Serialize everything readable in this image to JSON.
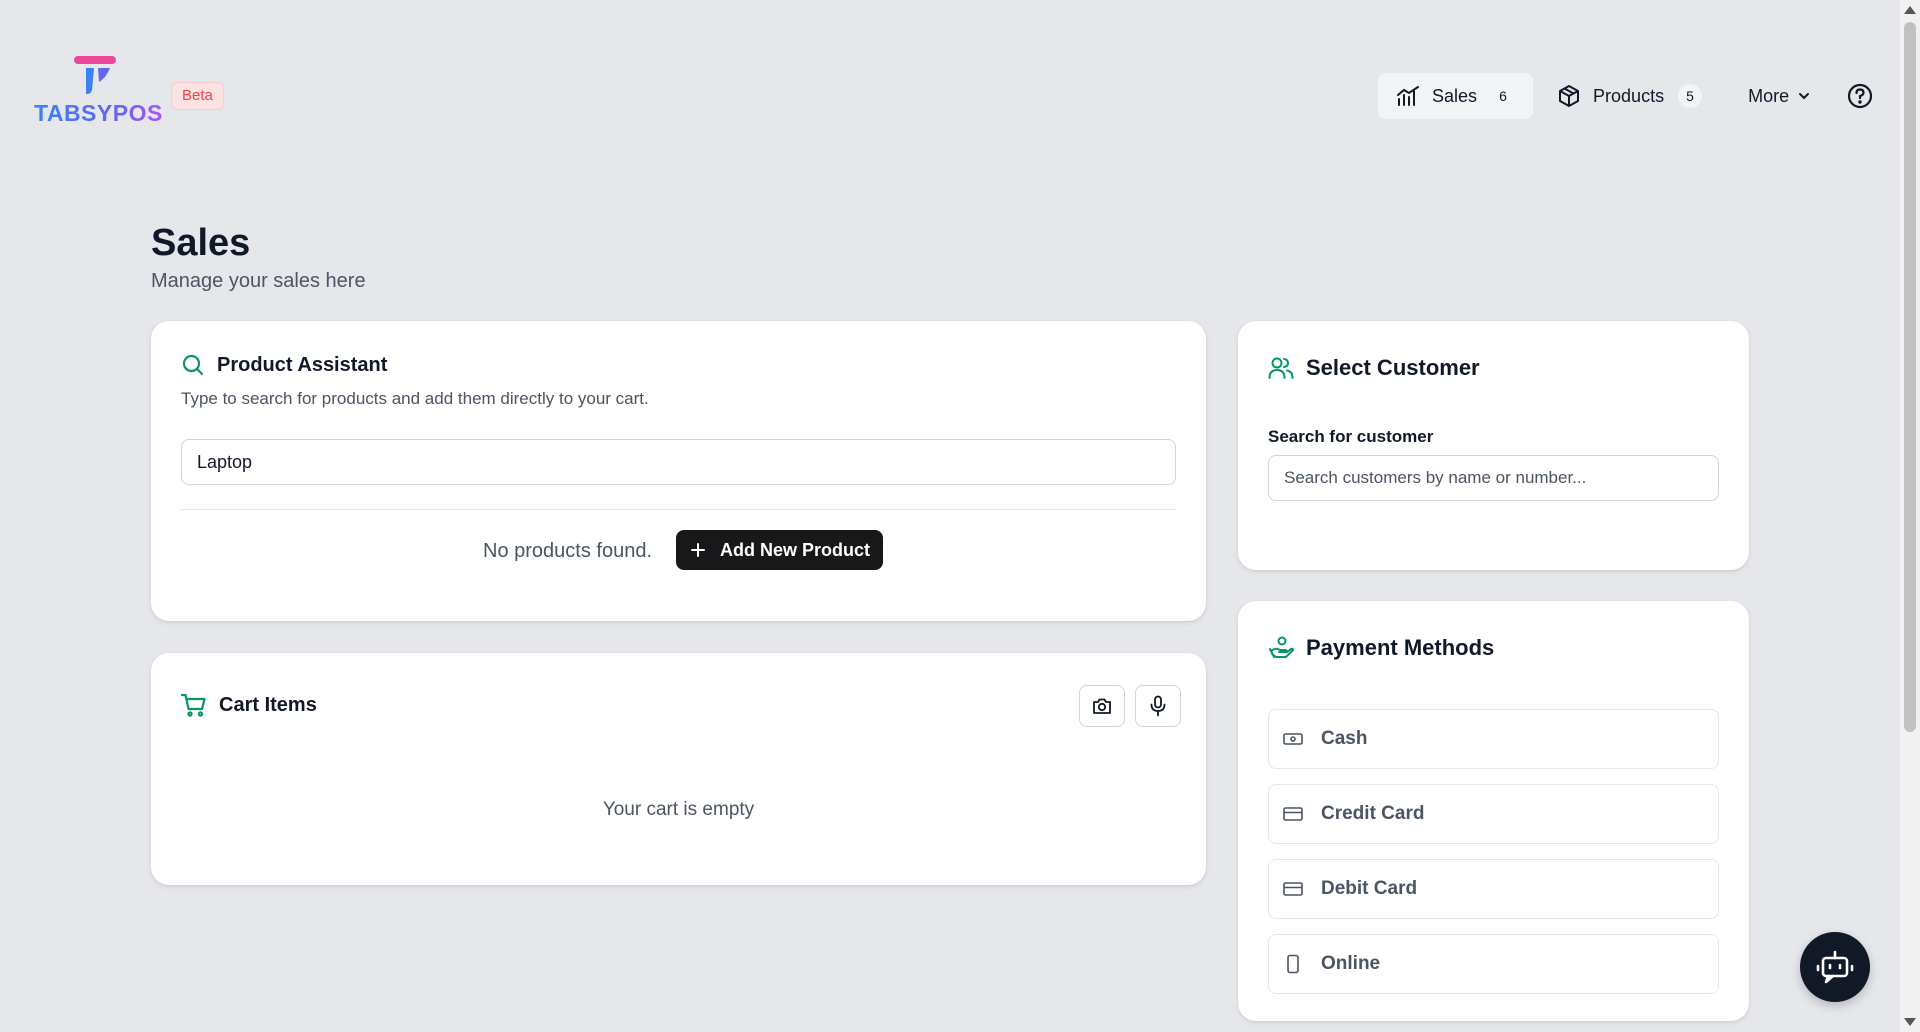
{
  "brand": {
    "logo_text": "TABSYPOS",
    "badge": "Beta"
  },
  "nav": {
    "items": [
      {
        "label": "Sales",
        "count": "6",
        "icon": "chart-bar-icon"
      },
      {
        "label": "Products",
        "count": "5",
        "icon": "box-icon"
      }
    ],
    "more_label": "More",
    "help_icon": "help-circle-icon"
  },
  "page": {
    "title": "Sales",
    "subtitle": "Manage your sales here"
  },
  "product_assistant": {
    "title": "Product Assistant",
    "description": "Type to search for products and add them directly to your cart.",
    "search_value": "Laptop",
    "empty_text": "No products found.",
    "add_button": "Add New Product"
  },
  "cart": {
    "title": "Cart Items",
    "empty_text": "Your cart is empty",
    "camera_icon": "camera-icon",
    "mic_icon": "microphone-icon"
  },
  "customer": {
    "title": "Select Customer",
    "search_label": "Search for customer",
    "search_placeholder": "Search customers by name or number..."
  },
  "payment": {
    "title": "Payment Methods",
    "methods": [
      {
        "label": "Cash",
        "icon": "banknote-icon"
      },
      {
        "label": "Credit Card",
        "icon": "credit-card-icon"
      },
      {
        "label": "Debit Card",
        "icon": "credit-card-icon"
      },
      {
        "label": "Online",
        "icon": "smartphone-icon"
      }
    ]
  },
  "colors": {
    "accent": "#059669",
    "dark": "#18181b",
    "background": "#e5e7eb",
    "beta": "#ef4444"
  }
}
